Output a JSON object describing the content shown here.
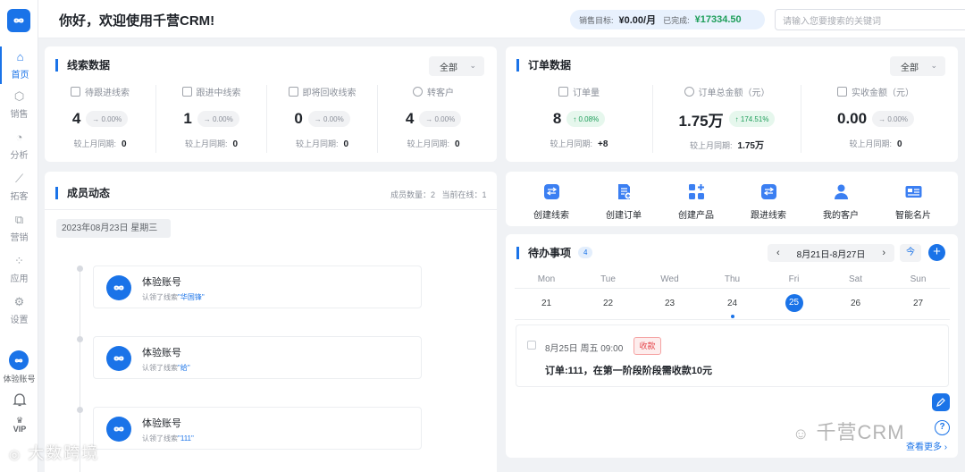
{
  "sidebar": {
    "items": [
      {
        "label": "首页",
        "icon": "home-icon",
        "active": true
      },
      {
        "label": "销售",
        "icon": "sales-icon"
      },
      {
        "label": "分析",
        "icon": "analysis-icon"
      },
      {
        "label": "拓客",
        "icon": "prospect-icon"
      },
      {
        "label": "营销",
        "icon": "marketing-icon"
      },
      {
        "label": "应用",
        "icon": "apps-icon"
      },
      {
        "label": "设置",
        "icon": "settings-icon"
      }
    ],
    "user_name": "体验账号",
    "vip_label": "VIP"
  },
  "header": {
    "greeting": "你好，欢迎使用千营CRM!",
    "target_label": "销售目标:",
    "target_value": "¥0.00/月",
    "done_label": "已完成:",
    "done_value": "¥17334.50",
    "search_placeholder": "请输入您要搜索的关键词"
  },
  "leads": {
    "title": "线索数据",
    "filter": "全部",
    "stats": [
      {
        "label": "待跟进线索",
        "value": "4",
        "pct": "→ 0.00%",
        "cmp_label": "较上月同期:",
        "cmp_value": "0"
      },
      {
        "label": "跟进中线索",
        "value": "1",
        "pct": "→ 0.00%",
        "cmp_label": "较上月同期:",
        "cmp_value": "0"
      },
      {
        "label": "即将回收线索",
        "value": "0",
        "pct": "→ 0.00%",
        "cmp_label": "较上月同期:",
        "cmp_value": "0"
      },
      {
        "label": "转客户",
        "value": "4",
        "pct": "→ 0.00%",
        "cmp_label": "较上月同期:",
        "cmp_value": "0"
      }
    ]
  },
  "orders": {
    "title": "订单数据",
    "filter": "全部",
    "stats": [
      {
        "label": "订单量",
        "value": "8",
        "pct": "↑ 0.08%",
        "up": true,
        "cmp_label": "较上月同期:",
        "cmp_value": "+8"
      },
      {
        "label": "订单总金额（元）",
        "value": "1.75万",
        "pct": "↑ 174.51%",
        "up": true,
        "cmp_label": "较上月同期:",
        "cmp_value": "1.75万"
      },
      {
        "label": "实收金额（元）",
        "value": "0.00",
        "pct": "→ 0.00%",
        "up": false,
        "cmp_label": "较上月同期:",
        "cmp_value": "0"
      }
    ]
  },
  "members": {
    "title": "成员动态",
    "count_label": "成员数量：2",
    "online_label": "当前在线：1",
    "date": "2023年08月23日 星期三",
    "activities": [
      {
        "name": "体验账号",
        "prefix": "认领了线索",
        "link": "\"华国锋\""
      },
      {
        "name": "体验账号",
        "prefix": "认领了线索",
        "link": "\"给\""
      },
      {
        "name": "体验账号",
        "prefix": "认领了线索",
        "link": "\"111\""
      }
    ]
  },
  "quick_actions": [
    {
      "label": "创建线索",
      "icon": "create-lead-icon"
    },
    {
      "label": "创建订单",
      "icon": "create-order-icon"
    },
    {
      "label": "创建产品",
      "icon": "create-product-icon"
    },
    {
      "label": "跟进线索",
      "icon": "follow-lead-icon"
    },
    {
      "label": "我的客户",
      "icon": "my-customer-icon"
    },
    {
      "label": "智能名片",
      "icon": "smart-card-icon"
    }
  ],
  "todo": {
    "title": "待办事项",
    "count": "4",
    "week_range": "8月21日-8月27日",
    "today_label": "今",
    "add_label": "+",
    "weekdays": [
      "Mon",
      "Tue",
      "Wed",
      "Thu",
      "Fri",
      "Sat",
      "Sun"
    ],
    "days": [
      "21",
      "22",
      "23",
      "24",
      "25",
      "26",
      "27"
    ],
    "today_index": 4,
    "item": {
      "time": "8月25日   周五   09:00",
      "tag": "收款",
      "text": "订单:111，在第一阶段阶段需收款10元"
    },
    "more_label": "查看更多 ›"
  },
  "watermarks": {
    "right": "千营CRM",
    "left": "大数跨境"
  },
  "colors": {
    "accent": "#1a73e8",
    "positive": "#1e9e5a",
    "warning": "#e5484d"
  }
}
